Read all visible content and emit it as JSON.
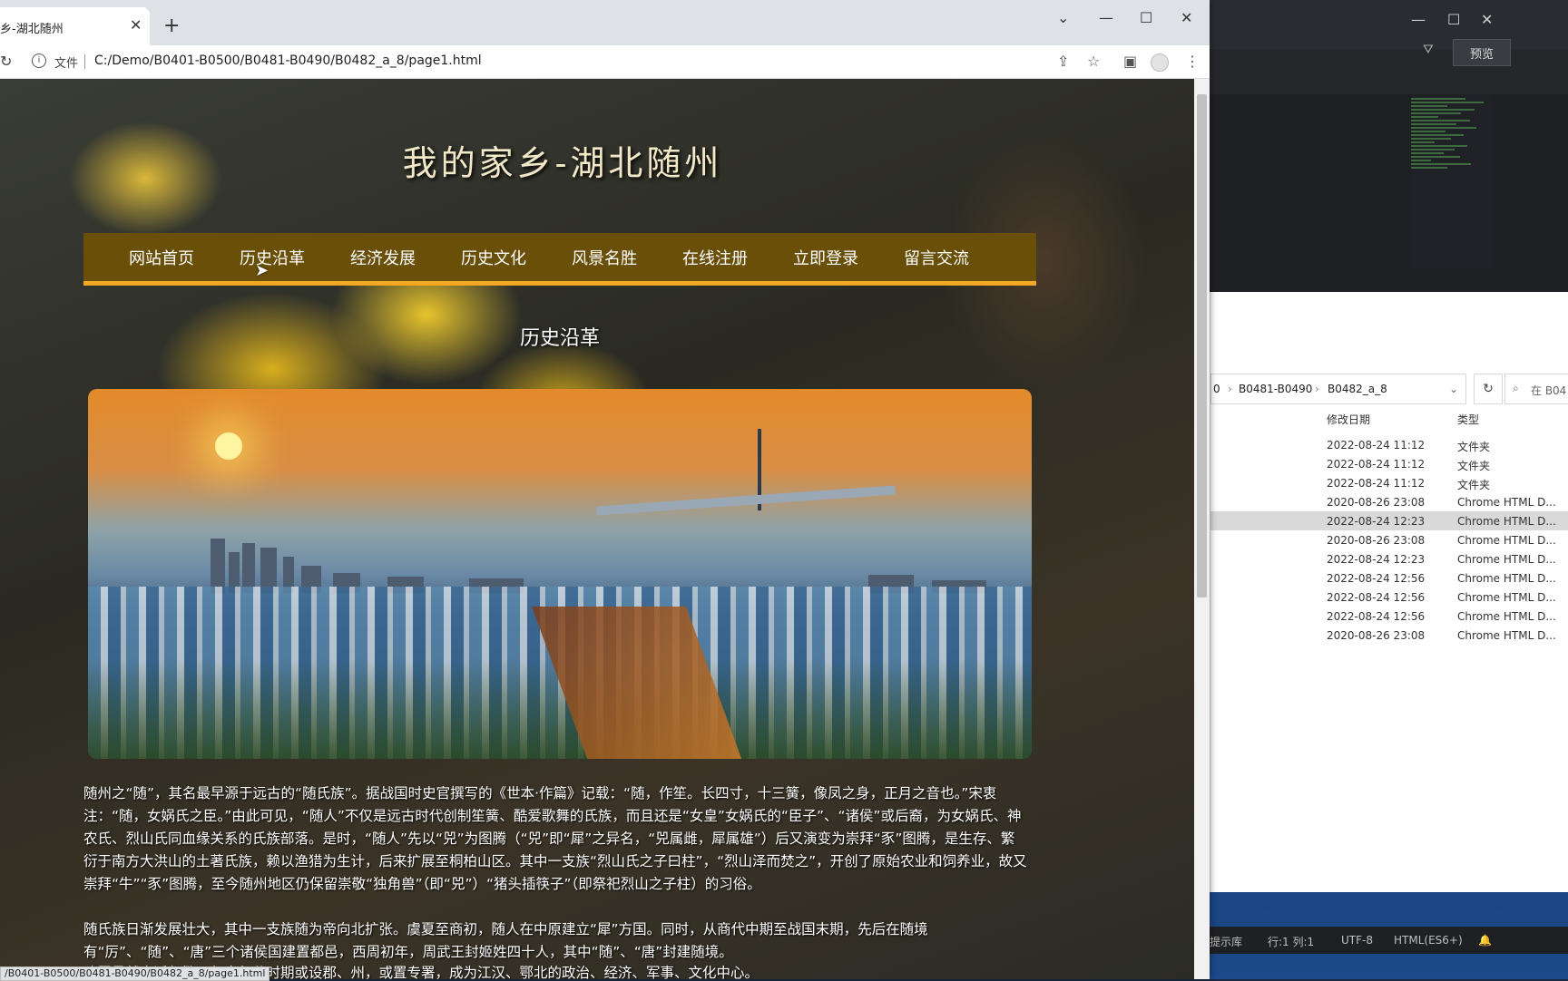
{
  "browser": {
    "tab_title": "乡-湖北随州",
    "file_label": "文件",
    "url": "C:/Demo/B0401-B0500/B0481-B0490/B0482_a_8/page1.html",
    "status_url": "/B0401-B0500/B0481-B0490/B0482_a_8/page1.html"
  },
  "site": {
    "title": "我的家乡-湖北随州",
    "nav": [
      "网站首页",
      "历史沿革",
      "经济发展",
      "历史文化",
      "风景名胜",
      "在线注册",
      "立即登录",
      "留言交流"
    ],
    "section_title": "历史沿革",
    "paragraphs": [
      "随州之“随”，其名最早源于远古的“随氏族”。据战国时史官撰写的《世本·作篇》记载：“随，作笙。长四寸，十三簧，像凤之身，正月之音也。”宋衷注：“随，女娲氏之臣。”由此可见，“随人”不仅是远古时代创制笙簧、酷爱歌舞的氏族，而且还是“女皇”女娲氏的“臣子”、“诸侯”或后裔，为女娲氏、神农氏、烈山氏同血缘关系的氏族部落。是时，“随人”先以“兕”为图腾（“兕”即“犀”之异名，“兕属雌，犀属雄”）后又演变为崇拜“豕”图腾，是生存、繁衍于南方大洪山的土著氏族，赖以渔猎为生计，后来扩展至桐柏山区。其中一支族“烈山氏之子曰柱”，“烈山泽而焚之”，开创了原始农业和饲养业，故又崇拜“牛”“豕”图腾，至今随州地区仍保留崇敬“独角兽”（即“兕”）“猪头插筷子”（即祭祀烈山之子柱）的习俗。",
      "随氏族日渐发展壮大，其中一支族随为帝向北扩张。虞夏至商初，随人在中原建立“犀”方国。同时，从商代中期至战国末期，先后在随境有“厉”、“随”、“唐”三个诸侯国建置都邑，西周初年，周武王封姬姓四十人，其中“随”、“唐”封建随境。",
      "建置虽然变迁频繁，但大部分时期或设郡、州，或置专署，成为江汉、鄂北的政治、经济、军事、文化中心。"
    ]
  },
  "editor": {
    "preview_label": "预览",
    "status": {
      "hint": "提示库",
      "position": "行:1 列:1",
      "encoding": "UTF-8",
      "mode": "HTML(ES6+)"
    }
  },
  "explorer": {
    "breadcrumb": [
      "0",
      "B0481-B0490",
      "B0482_a_8"
    ],
    "search_placeholder": "在 B04",
    "col_date": "修改日期",
    "col_type": "类型",
    "rows": [
      {
        "date": "2022-08-24 11:12",
        "type": "文件夹"
      },
      {
        "date": "2022-08-24 11:12",
        "type": "文件夹"
      },
      {
        "date": "2022-08-24 11:12",
        "type": "文件夹"
      },
      {
        "date": "2020-08-26 23:08",
        "type": "Chrome HTML D..."
      },
      {
        "date": "2022-08-24 12:23",
        "type": "Chrome HTML D..."
      },
      {
        "date": "2020-08-26 23:08",
        "type": "Chrome HTML D..."
      },
      {
        "date": "2022-08-24 12:23",
        "type": "Chrome HTML D..."
      },
      {
        "date": "2022-08-24 12:56",
        "type": "Chrome HTML D..."
      },
      {
        "date": "2022-08-24 12:56",
        "type": "Chrome HTML D..."
      },
      {
        "date": "2022-08-24 12:56",
        "type": "Chrome HTML D..."
      },
      {
        "date": "2020-08-26 23:08",
        "type": "Chrome HTML D..."
      }
    ]
  }
}
